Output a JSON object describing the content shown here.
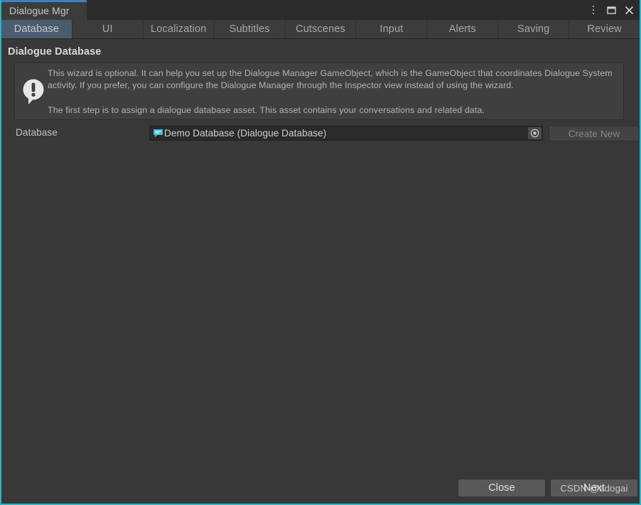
{
  "window": {
    "tab_title": "Dialogue Mgr",
    "accent_color": "#26b6c7",
    "tab_accent_color": "#3b81c4",
    "background_color": "#383838",
    "titlebar_icons": {
      "menu": "kebab-menu-icon",
      "maximize": "maximize-icon",
      "close": "close-icon"
    }
  },
  "tabs": [
    {
      "label": "Database",
      "active": true
    },
    {
      "label": "UI",
      "active": false
    },
    {
      "label": "Localization",
      "active": false
    },
    {
      "label": "Subtitles",
      "active": false
    },
    {
      "label": "Cutscenes",
      "active": false
    },
    {
      "label": "Input",
      "active": false
    },
    {
      "label": "Alerts",
      "active": false
    },
    {
      "label": "Saving",
      "active": false
    },
    {
      "label": "Review",
      "active": false
    }
  ],
  "main": {
    "section_title": "Dialogue Database",
    "helpbox": {
      "icon": "info-exclamation-icon",
      "paragraph1": "This wizard is optional. It can help you set up the Dialogue Manager GameObject, which is the GameObject that coordinates Dialogue System activity. If you prefer, you can configure the Dialogue Manager through the Inspector view instead of using the wizard.",
      "paragraph2": "The first step is to assign a dialogue database asset. This asset contains your conversations and related data."
    },
    "database_field": {
      "label": "Database",
      "value": "Demo Database (Dialogue Database)",
      "asset_icon": "dialogue-database-asset-icon",
      "picker_icon": "object-picker-icon",
      "create_new_label": "Create New",
      "create_new_enabled": false
    }
  },
  "footer": {
    "close_label": "Close",
    "next_label": "Next",
    "watermark": "CSDN @adogai"
  }
}
